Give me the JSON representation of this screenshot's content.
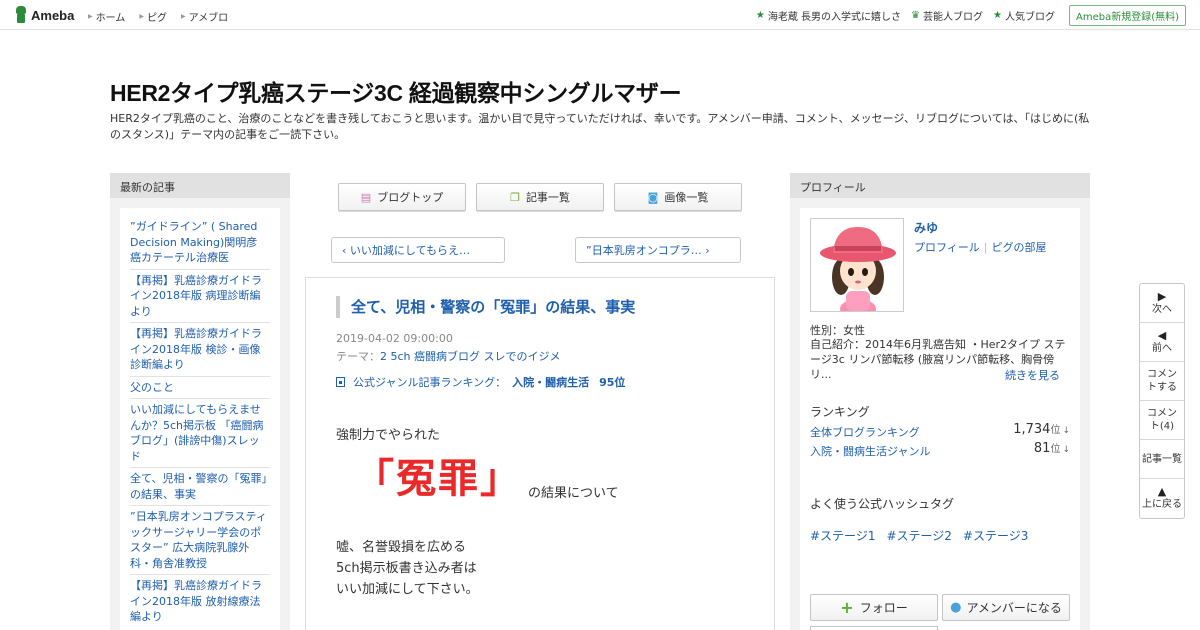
{
  "topbar": {
    "logo_text": "Ameba",
    "nav": [
      "ホーム",
      "ピグ",
      "アメブロ"
    ],
    "right_items": [
      {
        "icon": "star-icon",
        "label": "海老蔵 長男の入学式に嬉しさ"
      },
      {
        "icon": "crown-icon",
        "label": "芸能人ブログ"
      },
      {
        "icon": "star-icon",
        "label": "人気ブログ"
      }
    ],
    "signup_label": "Ameba新規登録(無料)"
  },
  "blog": {
    "title": "HER2タイプ乳癌ステージ3C 経過観察中シングルマザー",
    "description": "HER2タイプ乳癌のこと、治療のことなどを書き残しておこうと思います。温かい目で見守っていただければ、幸いです。アメンバー申請、コメント、メッセージ、リブログについては、「はじめに(私のスタンス)」テーマ内の記事をご一読下さい。"
  },
  "left_sidebar": {
    "heading": "最新の記事",
    "items": [
      "”ガイドライン” ( Shared Decision Making)関明彦 癌カテーテル治療医",
      "【再掲】乳癌診療ガイドライン2018年版 病理診断編より",
      "【再掲】乳癌診療ガイドライン2018年版 検診・画像診断編より",
      "父のこと",
      "いい加減にしてもらえませんか？5ch掲示板 「癌闘病ブログ」(誹謗中傷)スレッド",
      "全て、児相・警察の「冤罪」の結果、事実",
      "”日本乳房オンコプラスティックサージャリー学会のポスター” 広大病院乳腺外科・角舎准教授",
      "【再掲】乳癌診療ガイドライン2018年版 放射線療法編より"
    ]
  },
  "center": {
    "tabs": [
      {
        "icon": "document-icon",
        "label": "ブログトップ"
      },
      {
        "icon": "copy-icon",
        "label": "記事一覧"
      },
      {
        "icon": "camera-icon",
        "label": "画像一覧"
      }
    ],
    "prev_label": "‹ いい加減にしてもらえ…",
    "next_label": "”日本乳房オンコプラ… ›"
  },
  "article": {
    "title": "全て、児相・警察の「冤罪」の結果、事実",
    "date": "2019-04-02 09:00:00",
    "theme_prefix": "テーマ：",
    "theme": "2 5ch 癌闘病ブログ スレでのイジメ",
    "ranking_label": "公式ジャンル記事ランキング：",
    "ranking_genre": "入院・闘病生活",
    "ranking_rank": "95位",
    "line1": "強制力でやられた",
    "big_text": "「冤罪」",
    "after_big": "の結果について",
    "para": [
      "嘘、名誉毀損を広める",
      "5ch掲示板書き込み者は",
      "いい加減にして下さい。"
    ]
  },
  "right_sidebar": {
    "heading": "プロフィール",
    "name": "みゆ",
    "link_profile": "プロフィール",
    "link_pigg": "ピグの部屋",
    "gender": "性別：女性",
    "intro": "自己紹介：2014年6月乳癌告知 ・Her2タイプ ステージ3c リンパ節転移 (腋窩リンパ節転移、胸骨傍リ...",
    "more": "続きを見る",
    "ranking_heading": "ランキング",
    "rankings": [
      {
        "label": "全体ブログランキング",
        "value": "1,734",
        "unit": "位",
        "arrow": "↓"
      },
      {
        "label": "入院・闘病生活ジャンル",
        "value": "81",
        "unit": "位",
        "arrow": "↓"
      }
    ],
    "tag_heading": "よく使う公式ハッシュタグ",
    "tags": [
      "#ステージ1",
      "#ステージ2",
      "#ステージ3"
    ],
    "follow_label": "フォロー",
    "amember_label": "アメンバーになる"
  },
  "floatnav": [
    {
      "arrow": "▶",
      "label": "次へ"
    },
    {
      "arrow": "◀",
      "label": "前へ"
    },
    {
      "arrow": "",
      "label": "コメントする"
    },
    {
      "arrow": "",
      "label": "コメント(4)"
    },
    {
      "arrow": "",
      "label": "記事一覧"
    },
    {
      "arrow": "▲",
      "label": "上に戻る"
    }
  ],
  "colors": {
    "link": "#1f5fad",
    "accent_red": "#ea2a2a",
    "ameba_green": "#2d8c3c"
  }
}
